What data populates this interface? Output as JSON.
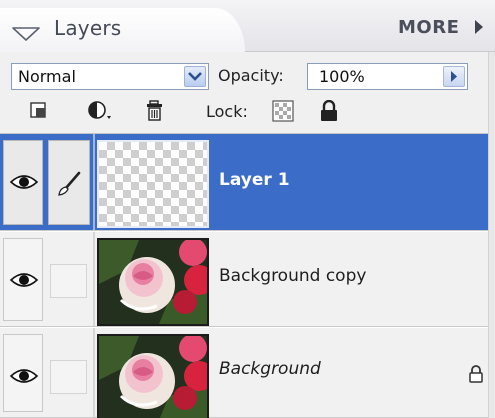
{
  "panel": {
    "title": "Layers",
    "more_label": "MORE"
  },
  "options": {
    "blend_mode": "Normal",
    "opacity_label": "Opacity:",
    "opacity_value": "100%",
    "lock_label": "Lock:"
  },
  "icons": {
    "collapse": "triangle-down-icon",
    "more_arrow": "triangle-right-icon",
    "new_layer": "new-layer-icon",
    "adjustment": "adjustment-layer-icon",
    "trash": "trash-icon",
    "lock_transparency": "checker-icon",
    "lock_all": "padlock-icon"
  },
  "layers": [
    {
      "name": "Layer 1",
      "selected": true,
      "visible": true,
      "thumbnail": "transparent",
      "locked": false,
      "brush": true
    },
    {
      "name": "Background copy",
      "selected": false,
      "visible": true,
      "thumbnail": "rose",
      "locked": false,
      "brush": false
    },
    {
      "name": "Background",
      "selected": false,
      "visible": true,
      "thumbnail": "rose",
      "locked": true,
      "italic": true,
      "brush": false
    }
  ],
  "colors": {
    "selection": "#3b6cc7",
    "panel_bg": "#f0f0f0",
    "header_text": "#454a58"
  }
}
